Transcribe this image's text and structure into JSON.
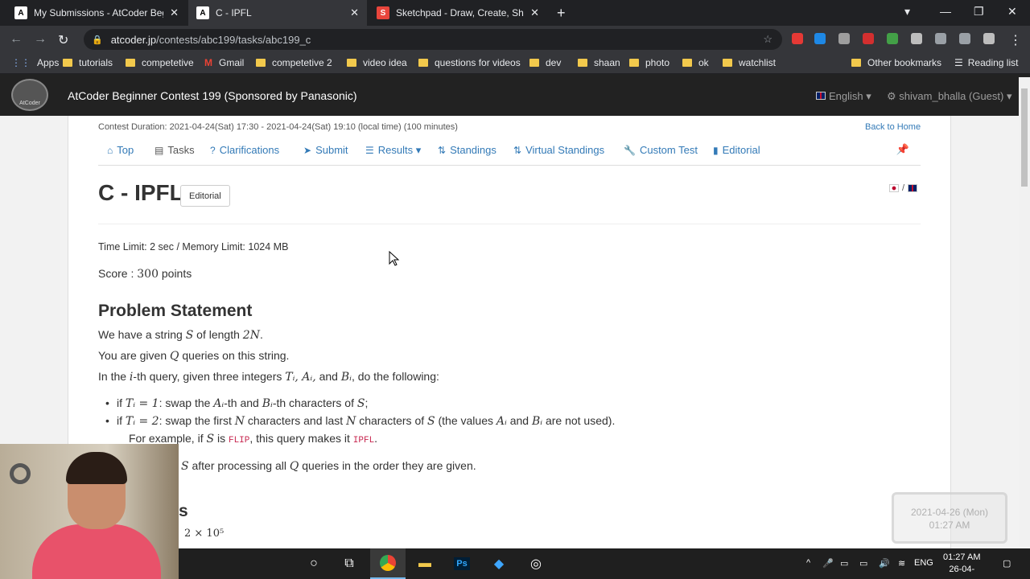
{
  "browser": {
    "tabs": [
      {
        "title": "My Submissions - AtCoder Beginn",
        "favicon": "atcoder-favicon",
        "active": false
      },
      {
        "title": "C - IPFL",
        "favicon": "atcoder-favicon",
        "active": true
      },
      {
        "title": "Sketchpad - Draw, Create, Share!",
        "favicon": "sketchpad-favicon",
        "active": false
      }
    ],
    "url_domain": "atcoder.jp",
    "url_path": "/contests/abc199/tasks/abc199_c",
    "bookmarks": [
      "Apps",
      "tutorials",
      "competetive",
      "Gmail",
      "competetive 2",
      "video idea",
      "questions for videos",
      "dev",
      "shaan",
      "photo",
      "ok",
      "watchlist"
    ],
    "other_bookmarks": "Other bookmarks",
    "reading_list": "Reading list"
  },
  "navbar": {
    "logo_text": "AtCoder",
    "contest_title": "AtCoder Beginner Contest 199  (Sponsored by Panasonic)",
    "language": "English",
    "user": "shivam_bhalla (Guest)"
  },
  "contest": {
    "duration": "Contest Duration: 2021-04-24(Sat) 17:30 - 2021-04-24(Sat) 19:10 (local time) (100 minutes)",
    "back_home": "Back to Home",
    "tabs": [
      "Top",
      "Tasks",
      "Clarifications",
      "Submit",
      "Results",
      "Standings",
      "Virtual Standings",
      "Custom Test",
      "Editorial"
    ]
  },
  "task": {
    "title": "C - IPFL",
    "editorial_button": "Editorial",
    "limits": "Time Limit: 2 sec / Memory Limit: 1024 MB",
    "score_label": "Score : ",
    "score_value": "300",
    "score_unit": " points",
    "section_title": "Problem Statement",
    "statement": {
      "l1a": "We have a string ",
      "l1b": "S",
      "l1c": " of length ",
      "l1d": "2N",
      "l1e": ".",
      "l2a": "You are given ",
      "l2b": "Q",
      "l2c": " queries on this string.",
      "l3a": "In the ",
      "l3b": "i",
      "l3c": "-th query, given three integers ",
      "l3d": "Tᵢ, Aᵢ,",
      "l3e": " and ",
      "l3f": "Bᵢ",
      "l3g": ", do the following:",
      "b1a": "if ",
      "b1b": "Tᵢ = 1",
      "b1c": ": swap the ",
      "b1d": "Aᵢ",
      "b1e": "-th and ",
      "b1f": "Bᵢ",
      "b1g": "-th characters of ",
      "b1h": "S",
      "b1i": ";",
      "b2a": "if ",
      "b2b": "Tᵢ = 2",
      "b2c": ": swap the first ",
      "b2d": "N",
      "b2e": " characters and last ",
      "b2f": "N",
      "b2g": " characters of ",
      "b2h": "S",
      "b2i": " (the values ",
      "b2j": "Aᵢ",
      "b2k": " and ",
      "b2l": "Bᵢ",
      "b2m": " are not used).",
      "b3a": "For example, if ",
      "b3b": "S",
      "b3c": " is ",
      "b3d": "FLIP",
      "b3e": ", this query makes it ",
      "b3f": "IPFL",
      "b3g": ".",
      "l4a": "S",
      "l4b": " after processing all ",
      "l4c": "Q",
      "l4d": " queries in the order they are given.",
      "partial_heading": "ts",
      "partial_line": "2 × 10⁵"
    }
  },
  "taskbar": {
    "lang": "ENG",
    "time": "01:27 AM",
    "date": "26-04-"
  },
  "watermark": {
    "line1": "2021-04-26 (Mon)",
    "line2": "01:27 AM"
  }
}
